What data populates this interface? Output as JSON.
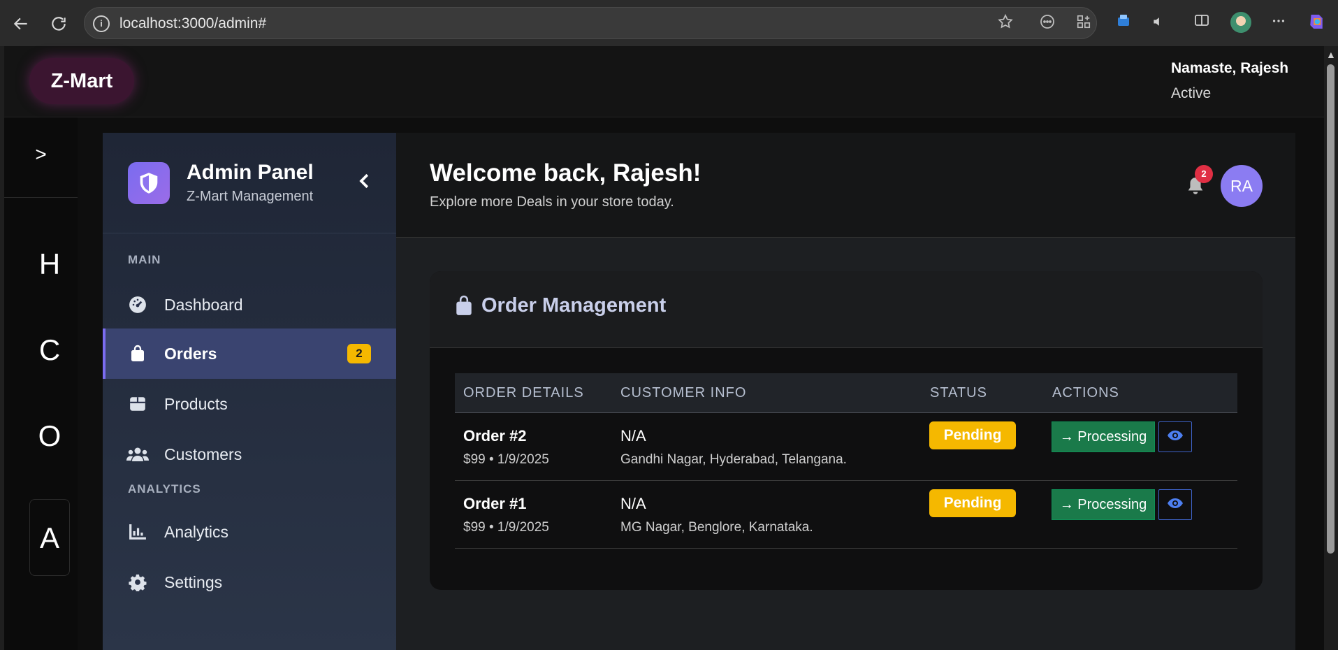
{
  "browser": {
    "url": "localhost:3000/admin#",
    "info_glyph": "i"
  },
  "header": {
    "brand": "Z-Mart",
    "greeting": "Namaste, Rajesh",
    "status": "Active"
  },
  "rail": {
    "toggle": ">",
    "letters": [
      "H",
      "C",
      "O",
      "A"
    ]
  },
  "sidebar": {
    "title": "Admin Panel",
    "subtitle": "Z-Mart Management",
    "sections": [
      "MAIN",
      "ANALYTICS"
    ],
    "items": [
      {
        "label": "Dashboard",
        "icon": "gauge-icon"
      },
      {
        "label": "Orders",
        "icon": "shopping-bag-icon",
        "badge": "2",
        "active": true
      },
      {
        "label": "Products",
        "icon": "box-icon"
      },
      {
        "label": "Customers",
        "icon": "users-icon"
      },
      {
        "label": "Analytics",
        "icon": "chart-bar-icon"
      },
      {
        "label": "Settings",
        "icon": "gear-icon"
      }
    ]
  },
  "topbar": {
    "welcome": "Welcome back, Rajesh!",
    "subtitle": "Explore more Deals in your store today.",
    "notification_count": "2",
    "avatar_initials": "RA"
  },
  "orders": {
    "title": "Order Management",
    "columns": [
      "ORDER DETAILS",
      "CUSTOMER INFO",
      "STATUS",
      "ACTIONS"
    ],
    "rows": [
      {
        "order": "Order #2",
        "meta": "$99 • 1/9/2025",
        "customer": "N/A",
        "address": "Gandhi Nagar, Hyderabad, Telangana.",
        "status": "Pending",
        "action": "→ Processing"
      },
      {
        "order": "Order #1",
        "meta": "$99 • 1/9/2025",
        "customer": "N/A",
        "address": "MG Nagar, Benglore, Karnataka.",
        "status": "Pending",
        "action": "→ Processing"
      }
    ]
  },
  "colors": {
    "accent": "#7b6cf0",
    "pending": "#f5b800",
    "processing": "#1a7a4a",
    "badge_red": "#e02f44"
  }
}
